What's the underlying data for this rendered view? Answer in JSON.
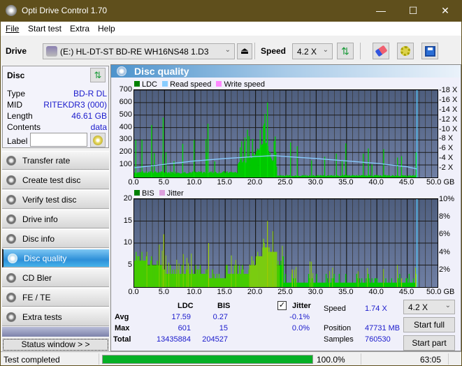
{
  "window": {
    "title": "Opti Drive Control 1.70",
    "minimize": "—",
    "maximize": "☐",
    "close": "✕"
  },
  "menu": [
    "File",
    "Start test",
    "Extra",
    "Help"
  ],
  "toolbar": {
    "drive_label": "Drive",
    "drive_value": "(E:)  HL-DT-ST BD-RE  WH16NS48 1.D3",
    "speed_label": "Speed",
    "speed_value": "4.2 X"
  },
  "disc": {
    "header": "Disc",
    "type_label": "Type",
    "type_value": "BD-R DL",
    "mid_label": "MID",
    "mid_value": "RITEKDR3 (000)",
    "length_label": "Length",
    "length_value": "46.61 GB",
    "contents_label": "Contents",
    "contents_value": "data",
    "label_label": "Label",
    "label_value": ""
  },
  "nav": [
    {
      "label": "Transfer rate",
      "active": false
    },
    {
      "label": "Create test disc",
      "active": false
    },
    {
      "label": "Verify test disc",
      "active": false
    },
    {
      "label": "Drive info",
      "active": false
    },
    {
      "label": "Disc info",
      "active": false
    },
    {
      "label": "Disc quality",
      "active": true
    },
    {
      "label": "CD Bler",
      "active": false
    },
    {
      "label": "FE / TE",
      "active": false
    },
    {
      "label": "Extra tests",
      "active": false
    }
  ],
  "status_window_label": "Status window > >",
  "panel_title": "Disc quality",
  "colors": {
    "ldc": "#00cc00",
    "read_speed": "#88ccff",
    "write_speed": "#ff88ff",
    "bis": "#00cc00",
    "jitter": "#dda0dd",
    "progress": "#06b025",
    "marker": "#55ccff"
  },
  "chart_data": [
    {
      "type": "bar",
      "title": "LDC",
      "legend": [
        "LDC",
        "Read speed",
        "Write speed"
      ],
      "legend_placement": "top-left",
      "xlabel": "GB",
      "xlim": [
        0,
        50
      ],
      "x_ticks": [
        "0.0",
        "5.0",
        "10.0",
        "15.0",
        "20.0",
        "25.0",
        "30.0",
        "35.0",
        "40.0",
        "45.0",
        "50.0 GB"
      ],
      "ylim_left": [
        0,
        700
      ],
      "y_ticks_left": [
        "700",
        "600",
        "500",
        "400",
        "300",
        "200",
        "100"
      ],
      "ylim_right": [
        0,
        18
      ],
      "y_ticks_right": [
        "18 X",
        "16 X",
        "14 X",
        "12 X",
        "10 X",
        "8 X",
        "6 X",
        "4 X",
        "2 X"
      ],
      "grid": true,
      "end_marker_gb": 46.61,
      "ldc_peaks": [
        [
          0.2,
          300
        ],
        [
          2.8,
          420
        ],
        [
          4.7,
          480
        ],
        [
          9.8,
          300
        ],
        [
          12.1,
          430
        ],
        [
          18.2,
          320
        ],
        [
          20.7,
          380
        ],
        [
          21.9,
          600
        ],
        [
          23.0,
          290
        ],
        [
          25.7,
          280
        ],
        [
          26.8,
          250
        ],
        [
          44.0,
          170
        ],
        [
          46.4,
          200
        ]
      ],
      "read_speed_x": [
        0,
        5,
        10,
        15,
        20,
        23,
        25,
        30,
        35,
        40,
        45,
        46.6
      ],
      "read_speed_values": [
        2.0,
        2.7,
        3.4,
        3.9,
        4.3,
        4.5,
        4.3,
        3.9,
        3.4,
        2.9,
        2.2,
        1.74
      ]
    },
    {
      "type": "bar",
      "title": "BIS",
      "legend": [
        "BIS",
        "Jitter"
      ],
      "legend_placement": "top-left",
      "xlabel": "GB",
      "xlim": [
        0,
        50
      ],
      "x_ticks": [
        "0.0",
        "5.0",
        "10.0",
        "15.0",
        "20.0",
        "25.0",
        "30.0",
        "35.0",
        "40.0",
        "45.0",
        "50.0 GB"
      ],
      "ylim_left": [
        0,
        20
      ],
      "y_ticks_left": [
        "20",
        "15",
        "10",
        "5"
      ],
      "ylim_right": [
        0,
        10
      ],
      "y_ticks_right": [
        "10%",
        "8%",
        "6%",
        "4%",
        "2%"
      ],
      "grid": true,
      "end_marker_gb": 46.61,
      "bis_level_x": [
        0,
        2,
        4.5,
        5,
        9,
        12,
        15,
        17.5,
        19,
        20,
        21,
        22,
        23.5,
        24.5,
        46.6
      ],
      "bis_level_values": [
        6,
        5,
        4,
        3,
        3,
        2,
        3,
        3,
        5,
        7,
        9,
        8,
        5,
        1,
        1
      ],
      "bis_peaks": [
        [
          4.8,
          12
        ],
        [
          12.2,
          10
        ],
        [
          21.9,
          15
        ],
        [
          26,
          4
        ],
        [
          44,
          2
        ],
        [
          46.4,
          3
        ]
      ]
    }
  ],
  "stats": {
    "col_ldc": "LDC",
    "col_bis": "BIS",
    "jitter_label": "Jitter",
    "jitter_checked": true,
    "avg_label": "Avg",
    "avg_ldc": "17.59",
    "avg_bis": "0.27",
    "avg_jitter": "-0.1%",
    "max_label": "Max",
    "max_ldc": "601",
    "max_bis": "15",
    "max_jitter": "0.0%",
    "total_label": "Total",
    "total_ldc": "13435884",
    "total_bis": "204527",
    "speed_label": "Speed",
    "speed_value": "1.74 X",
    "position_label": "Position",
    "position_value": "47731 MB",
    "samples_label": "Samples",
    "samples_value": "760530",
    "speed_select": "4.2 X",
    "start_full": "Start full",
    "start_part": "Start part"
  },
  "statusbar": {
    "status": "Test completed",
    "progress": 100.0,
    "progress_text": "100.0%",
    "elapsed": "63:05"
  }
}
